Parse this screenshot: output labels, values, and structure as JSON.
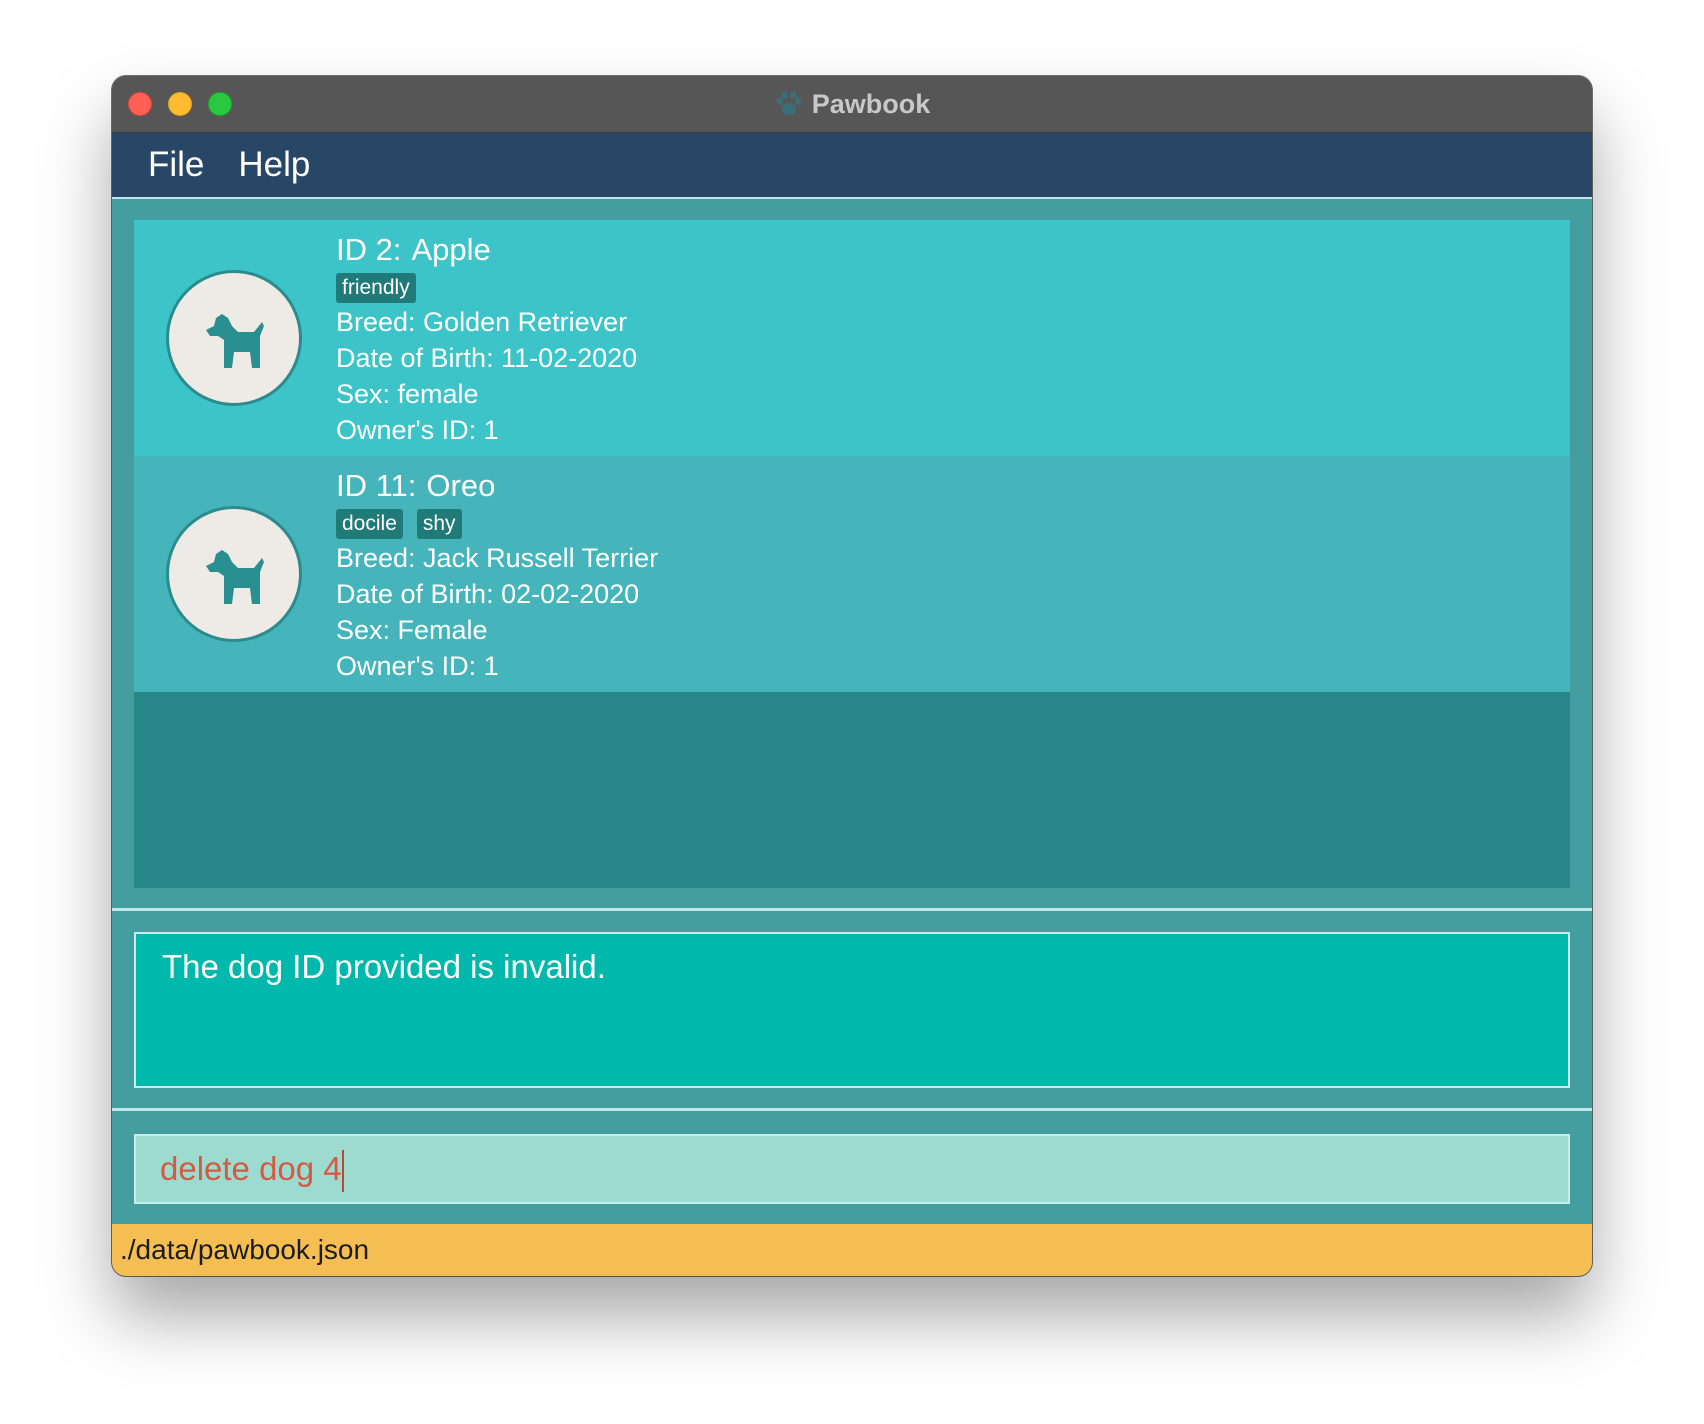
{
  "window": {
    "title": "Pawbook"
  },
  "menu": {
    "items": [
      {
        "label": "File"
      },
      {
        "label": "Help"
      }
    ]
  },
  "dogs": [
    {
      "id_label": "ID 2:",
      "name": "Apple",
      "tags": [
        "friendly"
      ],
      "breed": "Breed: Golden Retriever",
      "dob": "Date of Birth: 11-02-2020",
      "sex": "Sex: female",
      "owner": "Owner's ID: 1"
    },
    {
      "id_label": "ID 11:",
      "name": "Oreo",
      "tags": [
        "docile",
        "shy"
      ],
      "breed": "Breed: Jack Russell Terrier",
      "dob": "Date of Birth: 02-02-2020",
      "sex": "Sex: Female",
      "owner": "Owner's ID: 1"
    }
  ],
  "result": {
    "message": "The dog ID provided is invalid."
  },
  "command": {
    "value": "delete dog 4"
  },
  "status": {
    "file_path": "./data/pawbook.json"
  },
  "colors": {
    "menubar": "#284766",
    "card_selected": "#3cc4c8",
    "card": "#45b4bb",
    "list_bg": "#288788",
    "result_bg": "#00b8ac",
    "command_bg": "#9ddbd0",
    "command_text": "#d45a42",
    "statusbar": "#f4be52",
    "tag": "#1f7a78"
  },
  "icons": {
    "title": "paw-icon",
    "avatar": "dog-icon"
  }
}
